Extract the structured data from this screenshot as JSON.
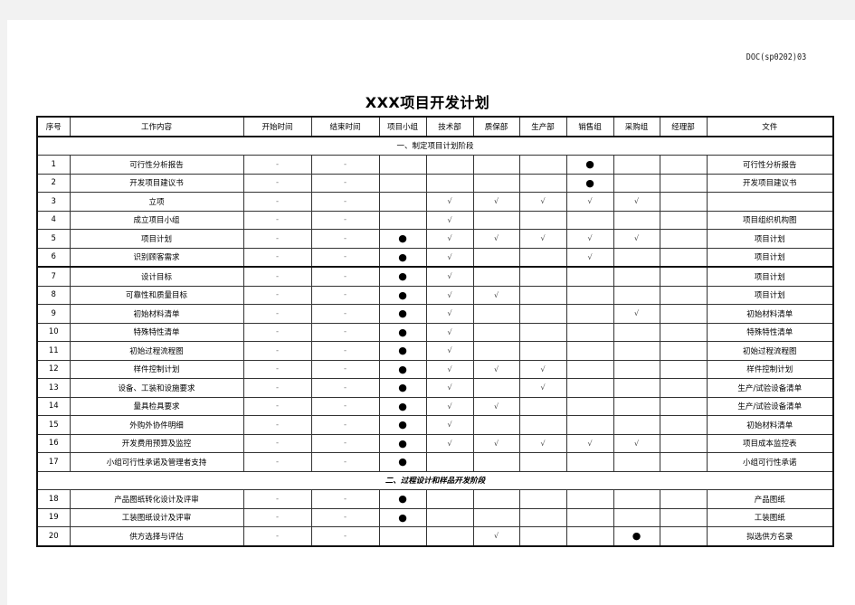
{
  "document": {
    "code": "DOC(sp0202)03",
    "title": "XXX项目开发计划"
  },
  "table": {
    "headers": [
      "序号",
      "工作内容",
      "开始时间",
      "结束时间",
      "项目小组",
      "技术部",
      "质保部",
      "生产部",
      "销售组",
      "采购组",
      "经理部",
      "文件"
    ],
    "symbols": {
      "responsible": "●",
      "participate": "√",
      "empty_time": "-"
    },
    "sections": [
      {
        "title": "一、制定项目计划阶段",
        "rows": [
          {
            "no": "1",
            "task": "可行性分析报告",
            "start": "-",
            "end": "-",
            "team": "",
            "tech": "",
            "qa": "",
            "prod": "",
            "sales": "●",
            "purch": "",
            "mgmt": "",
            "file": "可行性分析报告"
          },
          {
            "no": "2",
            "task": "开发项目建议书",
            "start": "-",
            "end": "-",
            "team": "",
            "tech": "",
            "qa": "",
            "prod": "",
            "sales": "●",
            "purch": "",
            "mgmt": "",
            "file": "开发项目建议书"
          },
          {
            "no": "3",
            "task": "立项",
            "start": "-",
            "end": "-",
            "team": "",
            "tech": "√",
            "qa": "√",
            "prod": "√",
            "sales": "√",
            "purch": "√",
            "mgmt": "",
            "file": ""
          },
          {
            "no": "4",
            "task": "成立项目小组",
            "start": "-",
            "end": "-",
            "team": "",
            "tech": "√",
            "qa": "",
            "prod": "",
            "sales": "",
            "purch": "",
            "mgmt": "",
            "file": "项目组织机构图"
          },
          {
            "no": "5",
            "task": "项目计划",
            "start": "-",
            "end": "-",
            "team": "●",
            "tech": "√",
            "qa": "√",
            "prod": "√",
            "sales": "√",
            "purch": "√",
            "mgmt": "",
            "file": "项目计划"
          },
          {
            "no": "6",
            "task": "识别顾客需求",
            "start": "-",
            "end": "-",
            "team": "●",
            "tech": "√",
            "qa": "",
            "prod": "",
            "sales": "√",
            "purch": "",
            "mgmt": "",
            "file": "项目计划"
          },
          {
            "no": "7",
            "task": "设计目标",
            "start": "-",
            "end": "-",
            "team": "●",
            "tech": "√",
            "qa": "",
            "prod": "",
            "sales": "",
            "purch": "",
            "mgmt": "",
            "file": "项目计划"
          },
          {
            "no": "8",
            "task": "可靠性和质量目标",
            "start": "-",
            "end": "-",
            "team": "●",
            "tech": "√",
            "qa": "√",
            "prod": "",
            "sales": "",
            "purch": "",
            "mgmt": "",
            "file": "项目计划"
          },
          {
            "no": "9",
            "task": "初始材料清单",
            "start": "-",
            "end": "-",
            "team": "●",
            "tech": "√",
            "qa": "",
            "prod": "",
            "sales": "",
            "purch": "√",
            "mgmt": "",
            "file": "初始材料清单"
          },
          {
            "no": "10",
            "task": "特殊特性清单",
            "start": "-",
            "end": "-",
            "team": "●",
            "tech": "√",
            "qa": "",
            "prod": "",
            "sales": "",
            "purch": "",
            "mgmt": "",
            "file": "特殊特性清单"
          },
          {
            "no": "11",
            "task": "初始过程流程图",
            "start": "-",
            "end": "-",
            "team": "●",
            "tech": "√",
            "qa": "",
            "prod": "",
            "sales": "",
            "purch": "",
            "mgmt": "",
            "file": "初始过程流程图"
          },
          {
            "no": "12",
            "task": "样件控制计划",
            "start": "-",
            "end": "-",
            "team": "●",
            "tech": "√",
            "qa": "√",
            "prod": "√",
            "sales": "",
            "purch": "",
            "mgmt": "",
            "file": "样件控制计划"
          },
          {
            "no": "13",
            "task": "设备、工装和设施要求",
            "start": "-",
            "end": "-",
            "team": "●",
            "tech": "√",
            "qa": "",
            "prod": "√",
            "sales": "",
            "purch": "",
            "mgmt": "",
            "file": "生产/试验设备清单"
          },
          {
            "no": "14",
            "task": "量具检具要求",
            "start": "-",
            "end": "-",
            "team": "●",
            "tech": "√",
            "qa": "√",
            "prod": "",
            "sales": "",
            "purch": "",
            "mgmt": "",
            "file": "生产/试验设备清单"
          },
          {
            "no": "15",
            "task": "外购外协件明细",
            "start": "-",
            "end": "-",
            "team": "●",
            "tech": "√",
            "qa": "",
            "prod": "",
            "sales": "",
            "purch": "",
            "mgmt": "",
            "file": "初始材料清单"
          },
          {
            "no": "16",
            "task": "开发费用预算及监控",
            "start": "-",
            "end": "-",
            "team": "●",
            "tech": "√",
            "qa": "√",
            "prod": "√",
            "sales": "√",
            "purch": "√",
            "mgmt": "",
            "file": "项目成本监控表"
          },
          {
            "no": "17",
            "task": "小组可行性承诺及管理者支持",
            "start": "-",
            "end": "-",
            "team": "●",
            "tech": "",
            "qa": "",
            "prod": "",
            "sales": "",
            "purch": "",
            "mgmt": "",
            "file": "小组可行性承诺"
          }
        ]
      },
      {
        "title": "二、过程设计和样品开发阶段",
        "rows": [
          {
            "no": "18",
            "task": "产品图纸转化设计及评审",
            "start": "-",
            "end": "-",
            "team": "●",
            "tech": "",
            "qa": "",
            "prod": "",
            "sales": "",
            "purch": "",
            "mgmt": "",
            "file": "产品图纸"
          },
          {
            "no": "19",
            "task": "工装图纸设计及评审",
            "start": "-",
            "end": "-",
            "team": "●",
            "tech": "",
            "qa": "",
            "prod": "",
            "sales": "",
            "purch": "",
            "mgmt": "",
            "file": "工装图纸"
          },
          {
            "no": "20",
            "task": "供方选择与评估",
            "start": "-",
            "end": "-",
            "team": "",
            "tech": "",
            "qa": "√",
            "prod": "",
            "sales": "",
            "purch": "●",
            "mgmt": "",
            "file": "拟选供方名录"
          }
        ]
      }
    ]
  }
}
